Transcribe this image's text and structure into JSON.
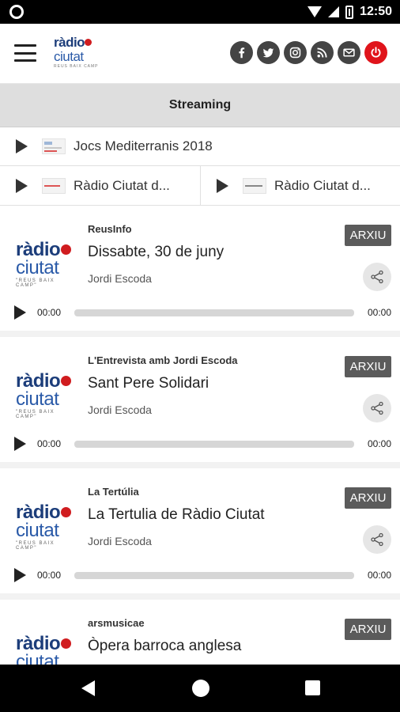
{
  "status_bar": {
    "time": "12:50"
  },
  "header": {
    "logo": {
      "line1": "ràdio",
      "line2": "ciutat",
      "tagline": "REUS BAIX CAMP"
    },
    "social_icons": [
      "facebook-icon",
      "twitter-icon",
      "instagram-icon",
      "rss-icon",
      "mail-icon",
      "power-icon"
    ],
    "power_color": "#e0141b"
  },
  "streaming": {
    "label": "Streaming"
  },
  "streams": [
    {
      "label": "Jocs Mediterranis 2018"
    },
    {
      "label": "Ràdio Ciutat d..."
    },
    {
      "label": "Ràdio Ciutat d..."
    }
  ],
  "card_logo": {
    "line1": "ràdio",
    "line2": "ciutat",
    "tagline": "\"REUS BAIX CAMP\""
  },
  "episodes": [
    {
      "program": "ReusInfo",
      "title": "Dissabte, 30 de juny",
      "author": "Jordi Escoda",
      "badge": "ARXIU",
      "time_start": "00:00",
      "time_end": "00:00",
      "progress": 0
    },
    {
      "program": "L'Entrevista amb Jordi Escoda",
      "title": "Sant Pere Solidari",
      "author": "Jordi Escoda",
      "badge": "ARXIU",
      "time_start": "00:00",
      "time_end": "00:00",
      "progress": 0
    },
    {
      "program": "La Tertúlia",
      "title": "La Tertulia de Ràdio Ciutat",
      "author": "Jordi Escoda",
      "badge": "ARXIU",
      "time_start": "00:00",
      "time_end": "00:00",
      "progress": 0
    },
    {
      "program": "arsmusicae",
      "title": "Òpera barroca anglesa",
      "author": "",
      "badge": "ARXIU",
      "time_start": "",
      "time_end": "",
      "progress": 0
    }
  ]
}
